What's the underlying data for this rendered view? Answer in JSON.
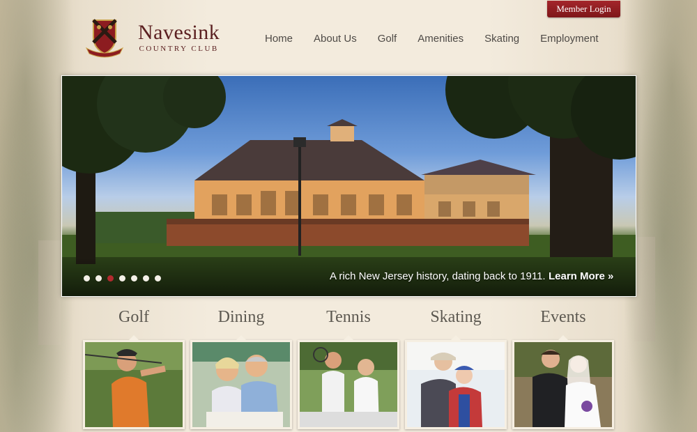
{
  "header": {
    "logo_name": "Navesink",
    "logo_sub": "COUNTRY CLUB",
    "member_login": "Member Login"
  },
  "nav": [
    {
      "label": "Home"
    },
    {
      "label": "About Us"
    },
    {
      "label": "Golf"
    },
    {
      "label": "Amenities"
    },
    {
      "label": "Skating"
    },
    {
      "label": "Employment"
    }
  ],
  "hero": {
    "caption": "A rich New Jersey history, dating back to 1911.",
    "learn_more": "Learn More »",
    "slides": 7,
    "active_slide": 3
  },
  "features": [
    {
      "title": "Golf"
    },
    {
      "title": "Dining"
    },
    {
      "title": "Tennis"
    },
    {
      "title": "Skating"
    },
    {
      "title": "Events"
    }
  ],
  "colors": {
    "brand_red": "#a4262b",
    "active_dot": "#b22a2e",
    "logo_text": "#5b2021"
  }
}
